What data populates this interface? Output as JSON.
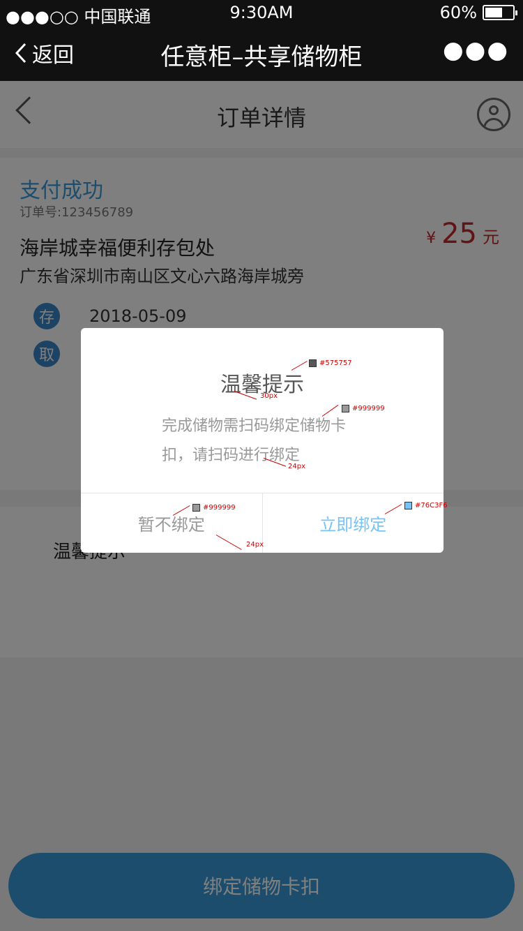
{
  "status_bar": {
    "carrier": "●●●○○ 中国联通",
    "time": "9:30AM",
    "battery": "60%"
  },
  "wechat_nav": {
    "back_label": "返回",
    "title": "任意柜–共享储物柜",
    "more": "●●●"
  },
  "app_header": {
    "title": "订单详情"
  },
  "order": {
    "status": "支付成功",
    "order_no": "订单号:123456789",
    "shop_name": "海岸城幸福便利存包处",
    "address": "广东省深圳市南山区文心六路海岸城旁",
    "currency": "¥",
    "amount": "25",
    "unit": "元",
    "deposit_badge": "存",
    "deposit_date": "2018-05-09",
    "pickup_badge": "取"
  },
  "tips": {
    "label": "温馨提示"
  },
  "bottom_button": "绑定储物卡扣",
  "dialog": {
    "title": "温馨提示",
    "message": "完成储物需扫码绑定储物卡扣，请扫码进行绑定",
    "cancel": "暂不绑定",
    "confirm": "立即绑定"
  },
  "annotations": {
    "title_color": "#575757",
    "title_size": "30px",
    "msg_color": "#999999",
    "msg_size": "24px",
    "cancel_color": "#999999",
    "cancel_size": "24px",
    "confirm_color": "#76C3F6"
  },
  "colors": {
    "accent": "#3a9bd8",
    "price": "#c0292c",
    "dialog_title": "#575757",
    "dialog_text": "#999999",
    "dialog_confirm": "#76C3F6"
  }
}
